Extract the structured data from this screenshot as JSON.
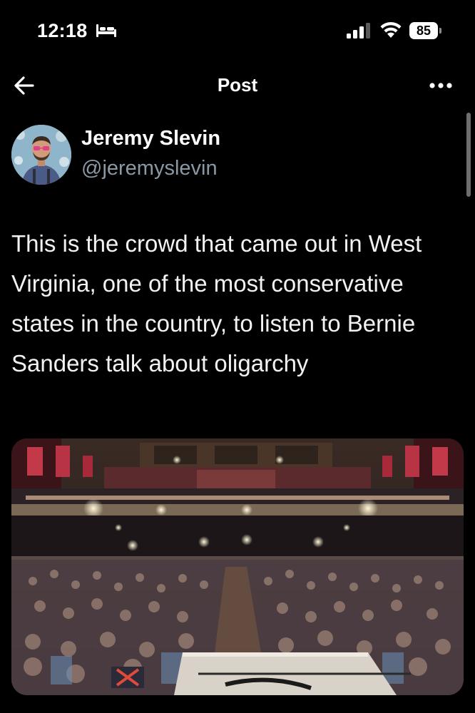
{
  "status_bar": {
    "time": "12:18",
    "battery": "85",
    "icons": [
      "sleep-mode-bed-icon",
      "cellular-signal-icon",
      "wifi-icon",
      "battery-icon"
    ]
  },
  "nav": {
    "title": "Post",
    "back_icon": "arrow-left-icon",
    "more_icon": "more-horizontal-icon"
  },
  "post": {
    "author": {
      "name": "Jeremy Slevin",
      "handle": "@jeremyslevin"
    },
    "text": "This is the crowd that came out in West Virginia, one of the most conservative states in the country, to listen to Bernie Sanders talk about oligarchy"
  },
  "colors": {
    "background": "#000000",
    "text_primary": "#e7e9ea",
    "text_secondary": "#8b98a5"
  }
}
